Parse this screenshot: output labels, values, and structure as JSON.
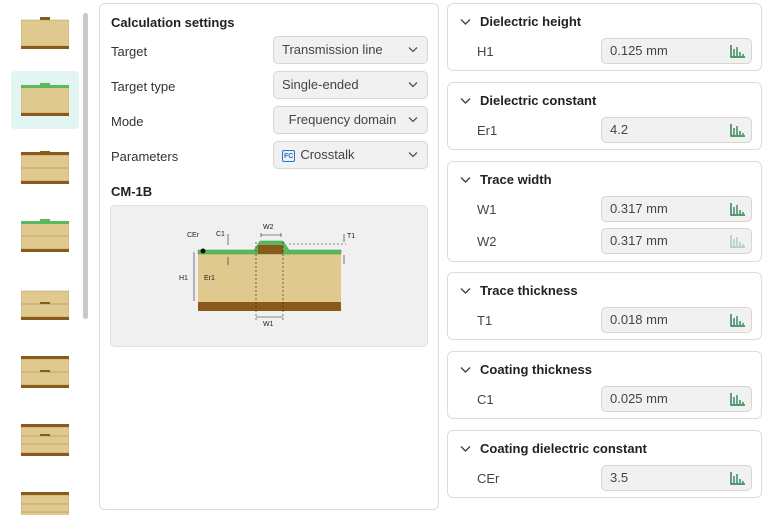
{
  "settings": {
    "title": "Calculation settings",
    "rows": [
      {
        "label": "Target",
        "value": "Transmission line"
      },
      {
        "label": "Target type",
        "value": "Single-ended"
      },
      {
        "label": "Mode",
        "value": "Frequency domain"
      },
      {
        "label": "Parameters",
        "value": "Crosstalk",
        "badge": "FC"
      }
    ],
    "model_name": "CM-1B",
    "diagram_labels": {
      "cer": "CEr",
      "c1": "C1",
      "w2": "W2",
      "t1": "T1",
      "h1": "H1",
      "er1": "Er1",
      "w1": "W1"
    }
  },
  "sections": [
    {
      "title": "Dielectric height",
      "fields": [
        {
          "label": "H1",
          "value": "0.125 mm"
        }
      ]
    },
    {
      "title": "Dielectric constant",
      "fields": [
        {
          "label": "Er1",
          "value": "4.2"
        }
      ]
    },
    {
      "title": "Trace width",
      "fields": [
        {
          "label": "W1",
          "value": "0.317 mm"
        },
        {
          "label": "W2",
          "value": "0.317 mm",
          "disabled": true
        }
      ]
    },
    {
      "title": "Trace thickness",
      "fields": [
        {
          "label": "T1",
          "value": "0.018 mm"
        }
      ]
    },
    {
      "title": "Coating thickness",
      "fields": [
        {
          "label": "C1",
          "value": "0.025 mm"
        }
      ]
    },
    {
      "title": "Coating dielectric constant",
      "fields": [
        {
          "label": "CEr",
          "value": "3.5"
        }
      ]
    }
  ],
  "colors": {
    "accent": "#2a9d8f",
    "substrate": "#e0c98f",
    "copper": "#8a5a1a",
    "coating": "#5cb85c"
  },
  "icons": {
    "chevron": "chevron-down-icon",
    "sweep": "sweep-chart-icon",
    "badge": "fc-badge-icon"
  }
}
